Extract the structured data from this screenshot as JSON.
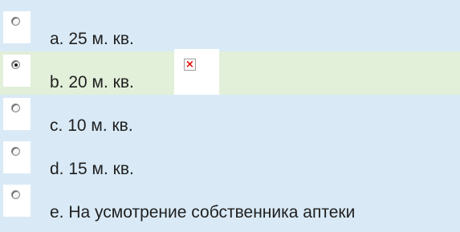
{
  "question_tail": "",
  "options": [
    {
      "letter": "a.",
      "text": "25 м. кв.",
      "selected": false
    },
    {
      "letter": "b.",
      "text": "20 м. кв.",
      "selected": true
    },
    {
      "letter": "c.",
      "text": "10 м. кв.",
      "selected": false
    },
    {
      "letter": "d.",
      "text": "15 м. кв.",
      "selected": false
    },
    {
      "letter": "e.",
      "text": "На усмотрение собственника аптеки",
      "selected": false
    }
  ],
  "broken_image_glyph": "×",
  "colors": {
    "background": "#d9eaf6",
    "selected_row": "#e2efd9",
    "text": "#1f1f1f",
    "broken_image_x": "#e00000"
  }
}
